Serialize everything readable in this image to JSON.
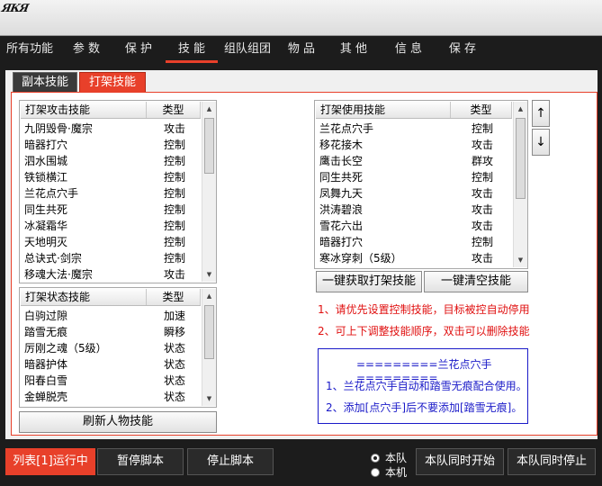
{
  "title": {
    "logo_text": "ЯКЯ"
  },
  "menu": [
    {
      "label": "所有功能"
    },
    {
      "label": "参 数"
    },
    {
      "label": "保 护"
    },
    {
      "label": "技 能"
    },
    {
      "label": "组队组团"
    },
    {
      "label": "物 品"
    },
    {
      "label": "其 他"
    },
    {
      "label": "信 息"
    },
    {
      "label": "保 存"
    }
  ],
  "subtabs": {
    "inactive": "副本技能",
    "active": "打架技能"
  },
  "attack_list": {
    "col_name": "打架攻击技能",
    "col_type": "类型",
    "rows": [
      {
        "name": "九阴毁骨·魔宗",
        "type": "攻击"
      },
      {
        "name": "暗器打穴",
        "type": "控制"
      },
      {
        "name": "泗水围城",
        "type": "控制"
      },
      {
        "name": "铁锁横江",
        "type": "控制"
      },
      {
        "name": "兰花点穴手",
        "type": "控制"
      },
      {
        "name": "同生共死",
        "type": "控制"
      },
      {
        "name": "冰凝霜华",
        "type": "控制"
      },
      {
        "name": "天地明灭",
        "type": "控制"
      },
      {
        "name": "总诀式·剑宗",
        "type": "控制"
      },
      {
        "name": "移魂大法·魔宗",
        "type": "攻击"
      }
    ]
  },
  "state_list": {
    "col_name": "打架状态技能",
    "col_type": "类型",
    "rows": [
      {
        "name": "白驹过隙",
        "type": "加速"
      },
      {
        "name": "踏雪无痕",
        "type": "瞬移"
      },
      {
        "name": "厉刚之魂（5级）",
        "type": "状态"
      },
      {
        "name": "暗器护体",
        "type": "状态"
      },
      {
        "name": "阳春白雪",
        "type": "状态"
      },
      {
        "name": "金蝉脱壳",
        "type": "状态"
      }
    ]
  },
  "use_list": {
    "col_name": "打架使用技能",
    "col_type": "类型",
    "rows": [
      {
        "name": "兰花点穴手",
        "type": "控制"
      },
      {
        "name": "移花接木",
        "type": "攻击"
      },
      {
        "name": "鹰击长空",
        "type": "群攻"
      },
      {
        "name": "同生共死",
        "type": "控制"
      },
      {
        "name": "凤舞九天",
        "type": "攻击"
      },
      {
        "name": "洪涛碧浪",
        "type": "攻击"
      },
      {
        "name": "雪花六出",
        "type": "攻击"
      },
      {
        "name": "暗器打穴",
        "type": "控制"
      },
      {
        "name": "寒冰穿刺（5级）",
        "type": "攻击"
      }
    ]
  },
  "buttons": {
    "refresh": "刷新人物技能",
    "fetch": "一键获取打架技能",
    "clear": "一键清空技能",
    "up": "↑",
    "down": "↓"
  },
  "notes": {
    "line1": "1、请优先设置控制技能，目标被控自动停用",
    "line2": "2、可上下调整技能顺序，双击可以删除技能"
  },
  "info": {
    "title": "=========兰花点穴手=========",
    "line1": "1、兰花点穴手自动和踏雪无痕配合使用。",
    "line2": "2、添加[点穴手]后不要添加[踏雪无痕]。"
  },
  "bottom": {
    "run": "列表[1]运行中",
    "pause": "暂停脚本",
    "stop": "停止脚本",
    "radio_team": "本队",
    "radio_machine": "本机",
    "team_start": "本队同时开始",
    "team_stop": "本队同时停止"
  },
  "colors": {
    "accent": "#e8402a",
    "info_blue": "#1a1ac8",
    "note_red": "#e01010"
  }
}
